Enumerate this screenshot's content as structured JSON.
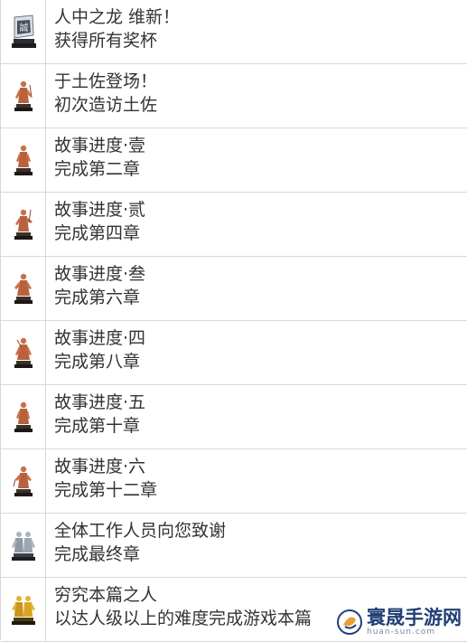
{
  "achievements": [
    {
      "title": "人中之龙 维新！",
      "desc": "获得所有奖杯",
      "icon": "seal-trophy-icon",
      "color": "#cfd6dc"
    },
    {
      "title": "于土佐登场！",
      "desc": "初次造访土佐",
      "icon": "samurai-statue-bronze-icon",
      "color": "#c9704a"
    },
    {
      "title": "故事进度·壹",
      "desc": "完成第二章",
      "icon": "samurai-statue-bronze-icon",
      "color": "#c9704a"
    },
    {
      "title": "故事进度·贰",
      "desc": "完成第四章",
      "icon": "samurai-statue-bronze-icon",
      "color": "#c9704a"
    },
    {
      "title": "故事进度·叁",
      "desc": "完成第六章",
      "icon": "samurai-statue-bronze-icon",
      "color": "#c9704a"
    },
    {
      "title": "故事进度·四",
      "desc": "完成第八章",
      "icon": "samurai-statue-bronze-icon",
      "color": "#c9704a"
    },
    {
      "title": "故事进度·五",
      "desc": "完成第十章",
      "icon": "samurai-statue-bronze-icon",
      "color": "#c9704a"
    },
    {
      "title": "故事进度·六",
      "desc": "完成第十二章",
      "icon": "samurai-statue-bronze-icon",
      "color": "#c9704a"
    },
    {
      "title": "全体工作人员向您致谢",
      "desc": "完成最终章",
      "icon": "samurai-statue-silver-icon",
      "color": "#a9b4c0"
    },
    {
      "title": "穷究本篇之人",
      "desc": "以达人级以上的难度完成游戏本篇",
      "icon": "samurai-statue-gold-icon",
      "color": "#d9a520"
    }
  ],
  "watermark": {
    "text": "寰晟手游网",
    "url": "huan-sun.com"
  }
}
